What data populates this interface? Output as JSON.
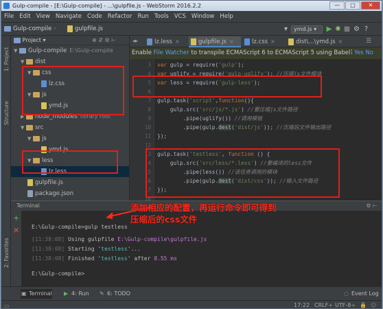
{
  "window": {
    "title": "Gulp-compile - [E:\\Gulp-compile] - ...\\gulpfile.js - WebStorm 2016.2.2",
    "buttons": [
      "—",
      "□",
      "✕"
    ]
  },
  "menu": [
    "File",
    "Edit",
    "View",
    "Navigate",
    "Code",
    "Refactor",
    "Run",
    "Tools",
    "VCS",
    "Window",
    "Help"
  ],
  "nav": {
    "crumb_project": "Gulp-compile",
    "crumb_file": "gulpfile.js",
    "run_config": "ymd.js"
  },
  "project_panel": {
    "header": "Project",
    "side_label": "1: Project",
    "structure_label": "Structure",
    "favorites_label": "2: Favorites",
    "tree": [
      {
        "label": "Gulp-compile",
        "hint": "E:\\Gulp-compile",
        "type": "folder-blue"
      },
      {
        "label": "dist",
        "hint": "",
        "type": "folder"
      },
      {
        "label": "css",
        "hint": "",
        "type": "folder"
      },
      {
        "label": "lz.css",
        "hint": "",
        "type": "css"
      },
      {
        "label": "js",
        "hint": "",
        "type": "folder"
      },
      {
        "label": "ymd.js",
        "hint": "",
        "type": "js"
      },
      {
        "label": "node_modules",
        "hint": "library root",
        "type": "folder"
      },
      {
        "label": "src",
        "hint": "",
        "type": "folder"
      },
      {
        "label": "js",
        "hint": "",
        "type": "folder"
      },
      {
        "label": "ymd.js",
        "hint": "",
        "type": "js"
      },
      {
        "label": "less",
        "hint": "",
        "type": "folder"
      },
      {
        "label": "lz.less",
        "hint": "",
        "type": "less"
      },
      {
        "label": "gulpfile.js",
        "hint": "",
        "type": "js"
      },
      {
        "label": "package.json",
        "hint": "",
        "type": "json"
      }
    ]
  },
  "editor": {
    "tabs": [
      {
        "label": "lz.less",
        "type": "less"
      },
      {
        "label": "gulpfile.js",
        "type": "js"
      },
      {
        "label": "lz.css",
        "type": "css"
      },
      {
        "label": "dist\\...\\ymd.js",
        "type": "js"
      }
    ],
    "banner_prefix": "Enable ",
    "banner_link": "File Watcher",
    "banner_suffix": " to transpile ECMAScript 6 to ECMAScript 5 using Babel?",
    "banner_yes": "Yes",
    "banner_no": "No",
    "line_numbers": [
      "3",
      "4",
      "5",
      "6",
      "7",
      "8",
      "9",
      "10",
      "11",
      "12",
      "13",
      "14",
      "15",
      "16",
      "17",
      "18"
    ]
  },
  "terminal": {
    "header": "Terminal",
    "lines": [
      {
        "type": "cmd",
        "text": "E:\\Gulp-compile>gulp testless"
      },
      {
        "type": "log",
        "time": "[11:38:08]",
        "a": " Using gulpfile ",
        "b": "E:\\Gulp-compile\\gulpfile.js"
      },
      {
        "type": "log",
        "time": "[11:38:08]",
        "a": " Starting '",
        "b": "testless",
        "c": "'..."
      },
      {
        "type": "log",
        "time": "[11:38:08]",
        "a": " Finished '",
        "b": "testless",
        "c": "' after ",
        "d": "8.55 ms"
      },
      {
        "type": "cmd",
        "text": "E:\\Gulp-compile>"
      }
    ]
  },
  "annotation": {
    "line1": "添加相应的配置，再运行命令即可得到",
    "line2": "压缩后的css文件"
  },
  "bottom_tools": [
    "Terminal",
    "4: Run",
    "6: TODO"
  ],
  "event_log": "Event Log",
  "status": {
    "position": "17:22",
    "line_sep": "CRLF÷",
    "encoding": "UTF-8÷"
  },
  "colors": {
    "annotation_red": "#ff2a1c",
    "keyword": "#cc7832",
    "string": "#6a8759"
  }
}
